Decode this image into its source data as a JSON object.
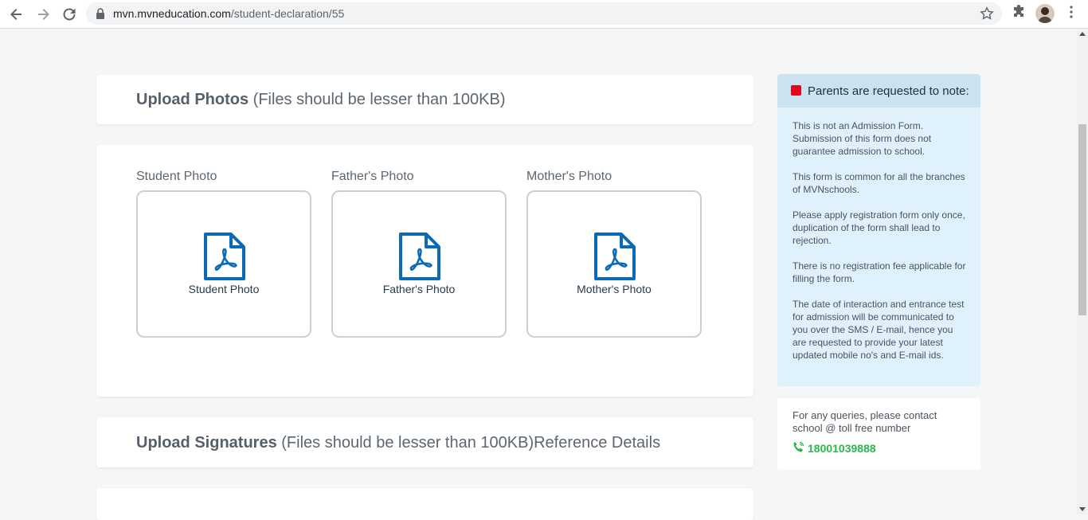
{
  "browser": {
    "url_domain": "mvn.mvneducation.com",
    "url_path": "/student-declaration/55",
    "icons": [
      "back-icon",
      "forward-icon",
      "reload-icon",
      "lock-icon",
      "star-icon",
      "extensions-icon",
      "menu-icon"
    ]
  },
  "upload_photos": {
    "title_bold": "Upload Photos",
    "title_note": "(Files should be lesser than 100KB)",
    "items": [
      {
        "label": "Student Photo",
        "caption": "Student Photo"
      },
      {
        "label": "Father's Photo",
        "caption": "Father's Photo"
      },
      {
        "label": "Mother's Photo",
        "caption": "Mother's Photo"
      }
    ],
    "icon_color": "#0a6ab6"
  },
  "upload_signatures": {
    "title_bold": "Upload Signatures",
    "title_note": "(Files should be lesser than 100KB)Reference Details"
  },
  "notes": {
    "title": "Parents are requested to note:",
    "accent_color": "#e2071f",
    "paragraphs": [
      "This is not an Admission Form. Submission of this form does not guarantee admission to school.",
      "This form is common for all the branches of MVNschools.",
      "Please apply registration form only once, duplication of the form shall lead to rejection.",
      "There is no registration fee applicable for filling the form.",
      "The date of interaction and entrance test for admission will be communicated to you over the SMS / E-mail, hence you are requested to provide your latest updated mobile no's and E-mail ids."
    ]
  },
  "contact": {
    "text": "For any queries, please contact school @ toll free number",
    "phone": "18001039888",
    "phone_color": "#2bb64a"
  }
}
